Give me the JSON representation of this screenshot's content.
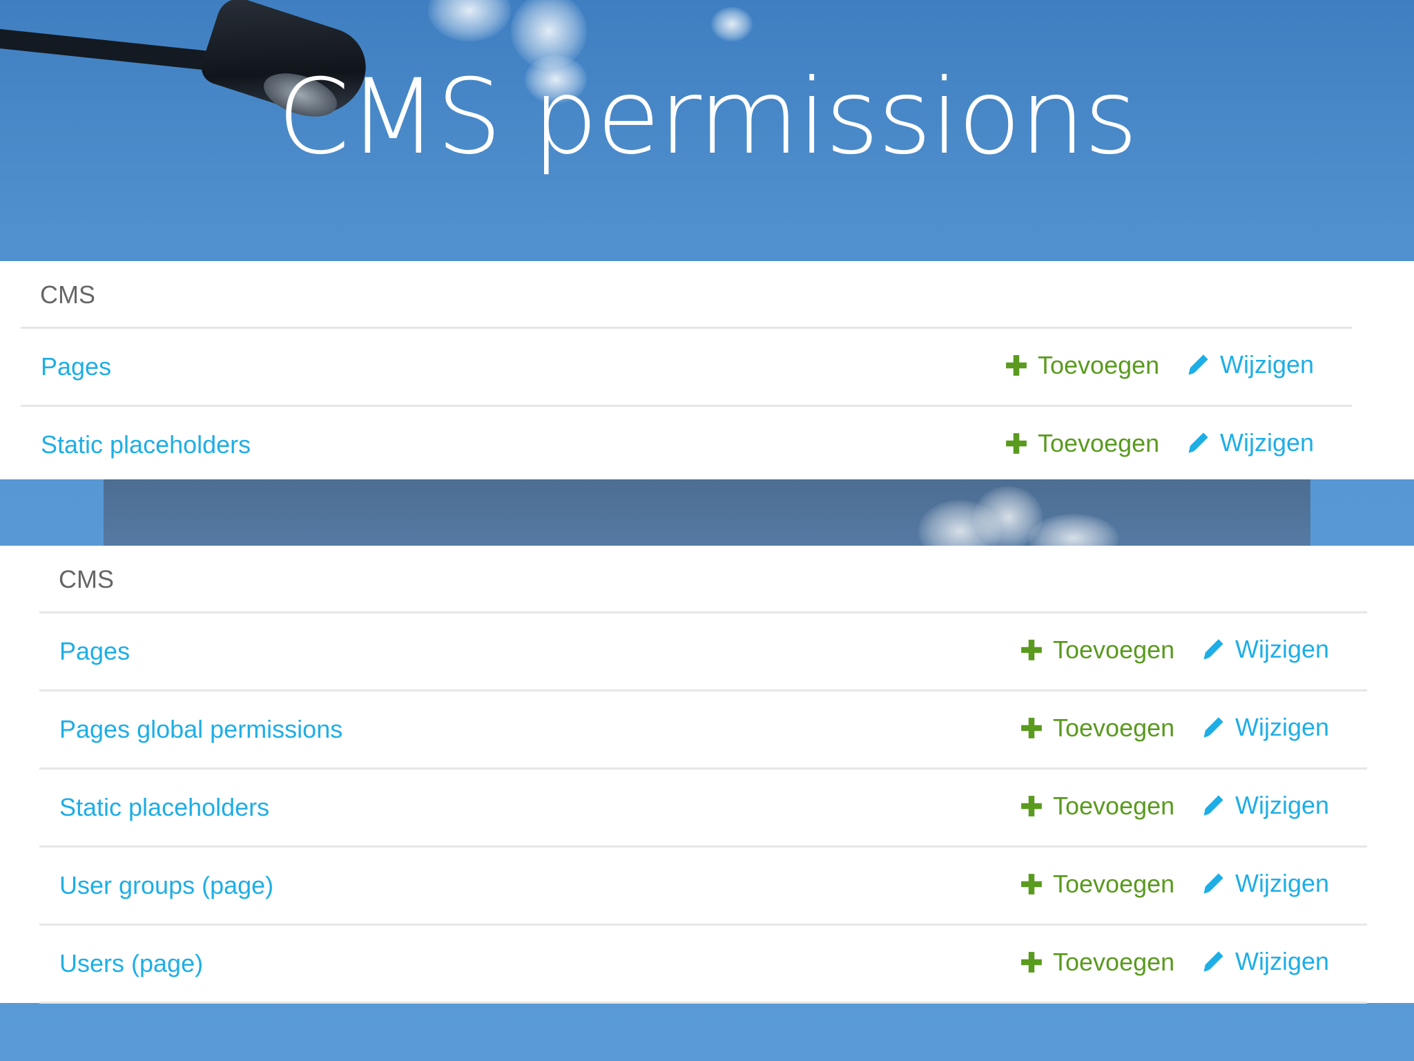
{
  "slide": {
    "title": "CMS permissions"
  },
  "colors": {
    "link": "#1eaee6",
    "add": "#5a9a1f",
    "caption": "#666666",
    "divider": "#e6e6e6"
  },
  "icons": {
    "add": "plus-icon",
    "change": "pencil-icon"
  },
  "panel_top": {
    "caption": "CMS",
    "rows": [
      {
        "name": "Pages",
        "add_label": "Toevoegen",
        "change_label": "Wijzigen"
      },
      {
        "name": "Static placeholders",
        "add_label": "Toevoegen",
        "change_label": "Wijzigen"
      }
    ]
  },
  "panel_bottom": {
    "caption": "CMS",
    "rows": [
      {
        "name": "Pages",
        "add_label": "Toevoegen",
        "change_label": "Wijzigen"
      },
      {
        "name": "Pages global permissions",
        "add_label": "Toevoegen",
        "change_label": "Wijzigen"
      },
      {
        "name": "Static placeholders",
        "add_label": "Toevoegen",
        "change_label": "Wijzigen"
      },
      {
        "name": "User groups (page)",
        "add_label": "Toevoegen",
        "change_label": "Wijzigen"
      },
      {
        "name": "Users (page)",
        "add_label": "Toevoegen",
        "change_label": "Wijzigen"
      }
    ]
  }
}
